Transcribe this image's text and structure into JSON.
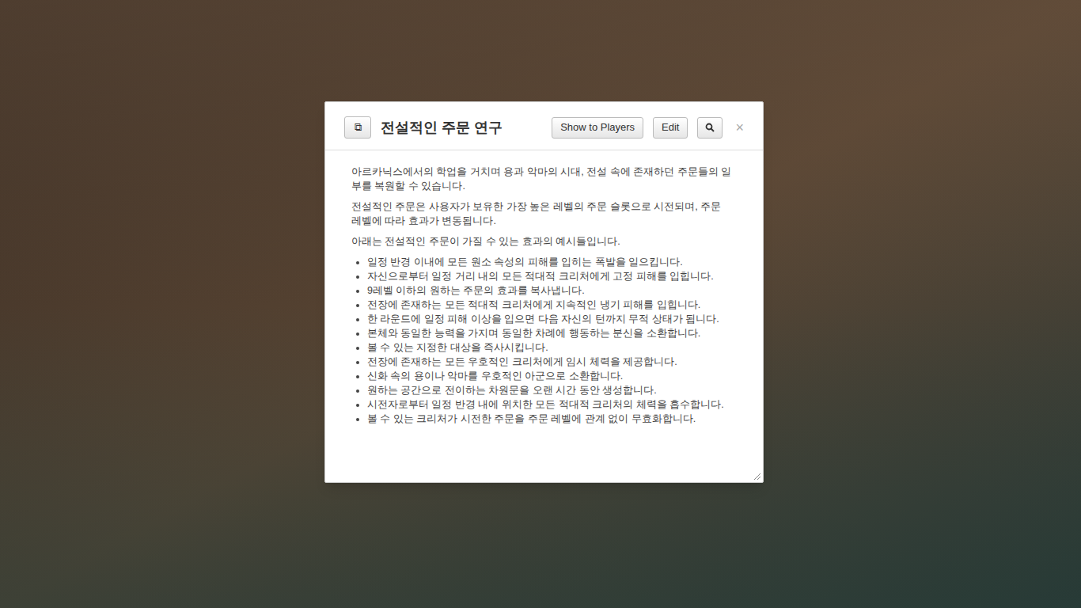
{
  "dialog": {
    "title": "전설적인 주문 연구",
    "copy_icon": "⧉",
    "buttons": [
      "Show to Players",
      "Edit"
    ],
    "close": "×"
  },
  "paragraphs": [
    "아르카닉스에서의 학업을 거치며 용과 악마의 시대, 전설 속에 존재하던 주문들의 일부를 복원할 수 있습니다.",
    "전설적인 주문은 사용자가 보유한 가장 높은 레벨의 주문 슬롯으로 시전되며, 주문 레벨에 따라 효과가 변동됩니다.",
    "아래는 전설적인 주문이 가질 수 있는 효과의 예시들입니다."
  ],
  "effects": [
    "일정 반경 이내에 모든 원소 속성의 피해를 입히는 폭발을 일으킵니다.",
    "자신으로부터 일정 거리 내의 모든 적대적 크리처에게 고정 피해를 입힙니다.",
    "9레벨 이하의 원하는 주문의 효과를 복사냅니다.",
    "전장에 존재하는 모든 적대적 크리처에게 지속적인 냉기 피해를 입힙니다.",
    "한 라운드에 일정 피해 이상을 입으면 다음 자신의 턴까지 무적 상태가 됩니다.",
    "본체와 동일한 능력을 가지며 동일한 차례에 행동하는 분신을 소환합니다.",
    "볼 수 있는 지정한 대상을 즉사시킵니다.",
    "전장에 존재하는 모든 우호적인 크리처에게 임시 체력을 제공합니다.",
    "신화 속의 용이나 악마를 우호적인 아군으로 소환합니다.",
    "원하는 공간으로 전이하는 차원문을 오랜 시간 동안 생성합니다.",
    "시전자로부터 일정 반경 내에 위치한 모든 적대적 크리처의 체력을 흡수합니다.",
    "볼 수 있는 크리처가 시전한 주문을 주문 레벨에 관계 없이 무효화합니다."
  ]
}
